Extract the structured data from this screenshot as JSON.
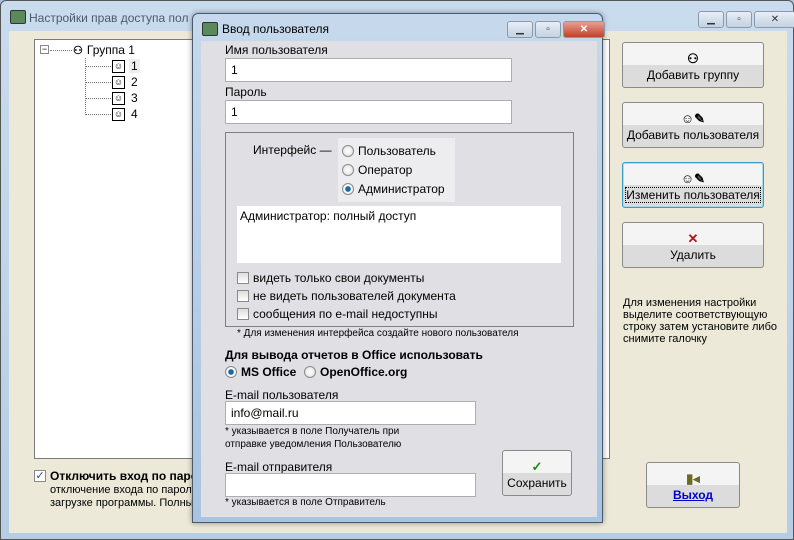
{
  "main_window": {
    "title": "Настройки прав доступа пол",
    "tree": {
      "group": "Группа 1",
      "users": [
        "1",
        "2",
        "3",
        "4"
      ]
    },
    "buttons": {
      "add_group": "Добавить группу",
      "add_user": "Добавить пользователя",
      "edit_user": "Изменить пользователя",
      "delete": "Удалить",
      "exit": "Выход"
    },
    "hint": "Для изменения настройки выделите соответствующую строку затем установите либо снимите галочку",
    "disable_password": {
      "label": "Отключить вход по паро",
      "checked": true,
      "desc1": "отключение входа по пароли",
      "desc2": "загрузке программы. Полны"
    }
  },
  "dialog": {
    "title": "Ввод пользователя",
    "username_label": "Имя пользователя",
    "username_value": "1",
    "password_label": "Пароль",
    "password_value": "1",
    "interface_label": "Интерфейс",
    "interface_dash": "—",
    "interface_options": [
      "Пользователь",
      "Оператор",
      "Администратор"
    ],
    "interface_selected": "Администратор",
    "description": "Администратор: полный доступ",
    "checkboxes": [
      "видеть только свои документы",
      "не видеть пользователей документа",
      "сообщения по e-mail недоступны"
    ],
    "interface_note": "* Для изменения интерфейса создайте нового пользователя",
    "office_label": "Для вывода отчетов в Office использовать",
    "office_options": [
      "MS Office",
      "OpenOffice.org"
    ],
    "office_selected": "MS Office",
    "user_email_label": "E-mail пользователя",
    "user_email_value": "info@mail.ru",
    "user_email_note1": "* указывается в поле Получатель при",
    "user_email_note2": "отправке уведомления Пользователю",
    "sender_email_label": "E-mail отправителя",
    "sender_email_value": "",
    "sender_email_note": "* указывается в поле Отправитель",
    "save": "Сохранить"
  }
}
